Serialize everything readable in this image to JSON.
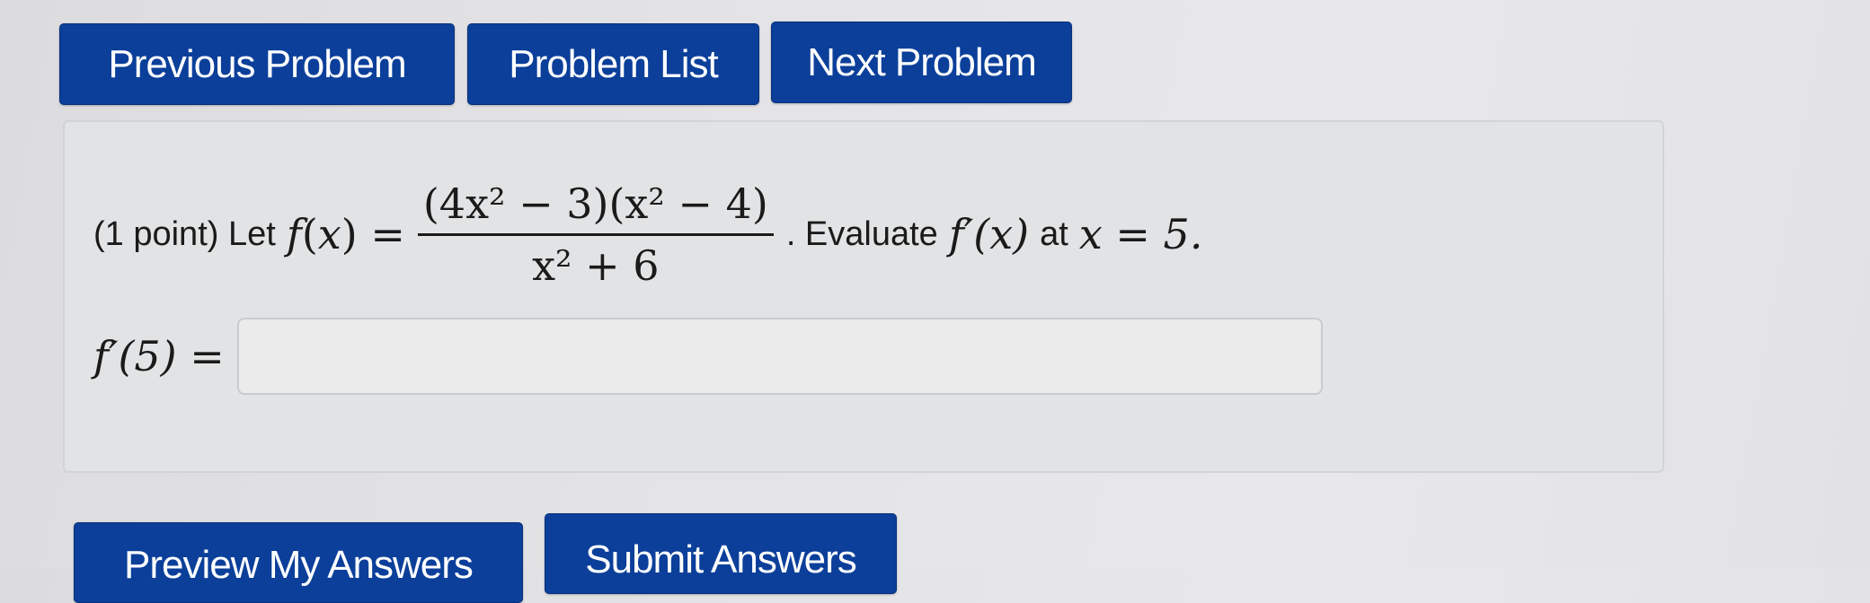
{
  "nav": {
    "previous_label": "Previous Problem",
    "list_label": "Problem List",
    "next_label": "Next Problem"
  },
  "problem": {
    "points_text": "(1 point) Let",
    "func_name": "f",
    "var": "x",
    "equals": "=",
    "numerator_factor1": "(4x² − 3)",
    "numerator_factor2": "(x² − 4)",
    "denominator": "x² + 6",
    "evaluate_text": ". Evaluate",
    "derivative": "f′(x)",
    "at_text": "at",
    "condition": "x = 5."
  },
  "answer": {
    "label": "f′(5) =",
    "value": "",
    "placeholder": ""
  },
  "actions": {
    "preview_label": "Preview My Answers",
    "submit_label": "Submit Answers"
  },
  "colors": {
    "button_bg": "#0b3f9a",
    "button_text": "#ffffff",
    "panel_bg": "#e2e3e4"
  }
}
